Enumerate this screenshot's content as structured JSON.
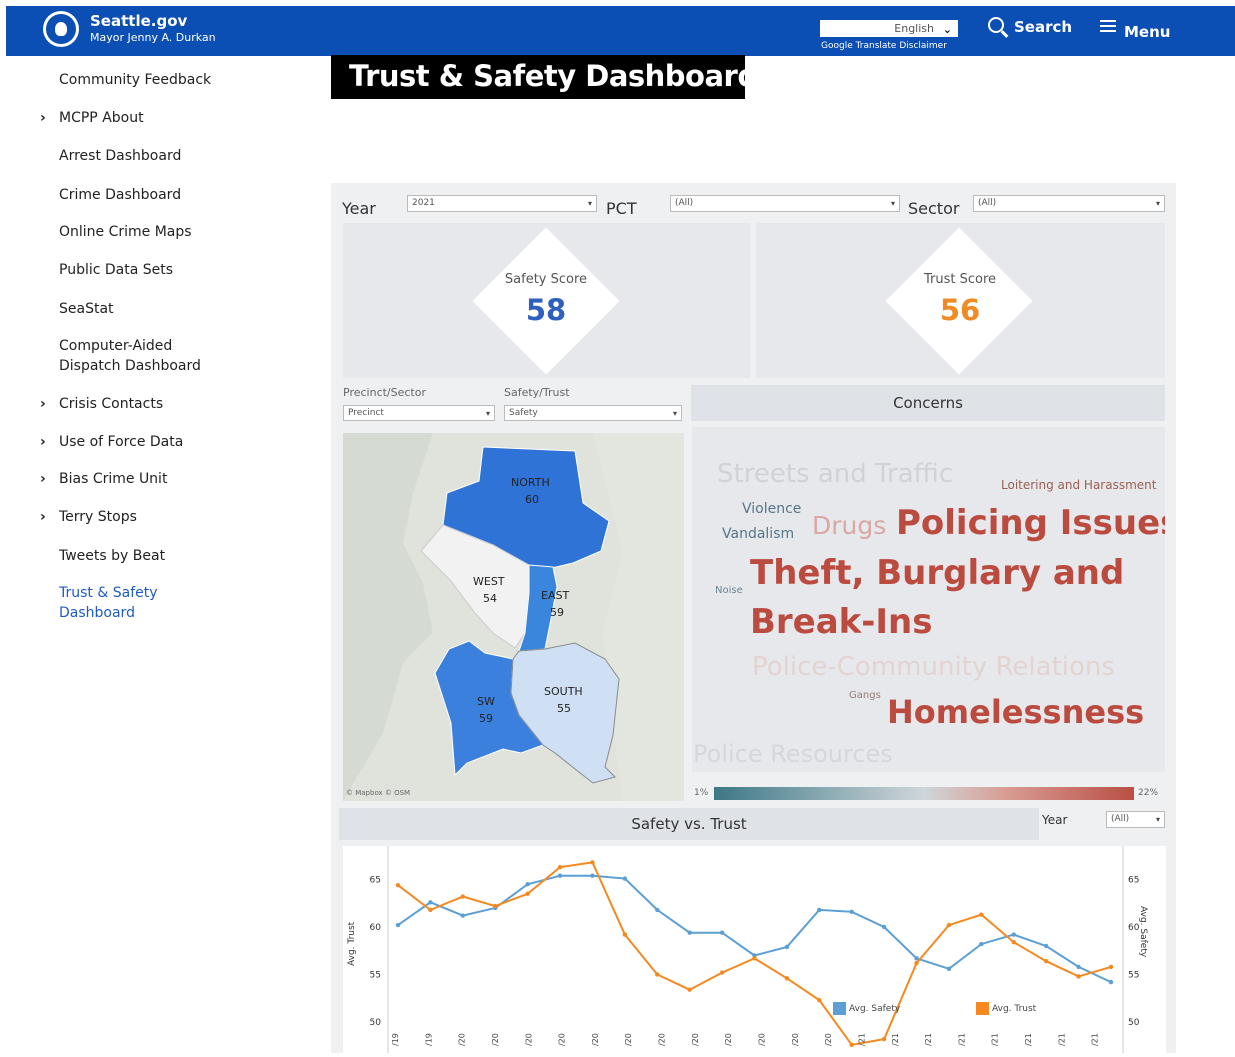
{
  "header": {
    "site_name": "Seattle.gov",
    "mayor": "Mayor Jenny A. Durkan",
    "language": "English",
    "translate_disclaimer": "Google Translate Disclaimer",
    "search_label": "Search",
    "menu_label": "Menu"
  },
  "sidebar": {
    "items": [
      {
        "label": "Community Feedback",
        "has_children": false
      },
      {
        "label": "MCPP About",
        "has_children": true
      },
      {
        "label": "Arrest Dashboard",
        "has_children": false
      },
      {
        "label": "Crime Dashboard",
        "has_children": false
      },
      {
        "label": "Online Crime Maps",
        "has_children": false
      },
      {
        "label": "Public Data Sets",
        "has_children": false
      },
      {
        "label": "SeaStat",
        "has_children": false
      },
      {
        "label": "Computer-Aided Dispatch Dashboard",
        "has_children": false
      },
      {
        "label": "Crisis Contacts",
        "has_children": true
      },
      {
        "label": "Use of Force Data",
        "has_children": true
      },
      {
        "label": "Bias Crime Unit",
        "has_children": true
      },
      {
        "label": "Terry Stops",
        "has_children": true
      },
      {
        "label": "Tweets by Beat",
        "has_children": false
      },
      {
        "label": "Trust & Safety Dashboard",
        "has_children": false,
        "active": true
      }
    ]
  },
  "page_title": "Trust & Safety Dashboard",
  "filters": {
    "year_label": "Year",
    "year_value": "2021",
    "pct_label": "PCT",
    "pct_value": "(All)",
    "sector_label": "Sector",
    "sector_value": "(All)"
  },
  "scores": {
    "safety_label": "Safety Score",
    "safety_value": "58",
    "trust_label": "Trust Score",
    "trust_value": "56",
    "safety_color": "#2f5fbf",
    "trust_color": "#f08a24"
  },
  "map_controls": {
    "precinct_sector_label": "Precinct/Sector",
    "precinct_sector_value": "Precinct",
    "safety_trust_label": "Safety/Trust",
    "safety_trust_value": "Safety"
  },
  "map": {
    "attribution": "© Mapbox © OSM",
    "regions": [
      {
        "name": "NORTH",
        "value": "60"
      },
      {
        "name": "WEST",
        "value": "54"
      },
      {
        "name": "EAST",
        "value": "59"
      },
      {
        "name": "SW",
        "value": "59"
      },
      {
        "name": "SOUTH",
        "value": "55"
      }
    ]
  },
  "concerns": {
    "title": "Concerns",
    "words": {
      "streets": "Streets and Traffic",
      "loitering": "Loitering and Harassment",
      "violence": "Violence",
      "vandalism": "Vandalism",
      "drugs": "Drugs",
      "policing": "Policing Issues",
      "noise": "Noise",
      "theft1": "Theft, Burglary and",
      "theft2": "Break-Ins",
      "pcr": "Police-Community Relations",
      "gangs": "Gangs",
      "homelessness": "Homelessness",
      "resources": "Police Resources"
    },
    "legend_min": "1%",
    "legend_max": "22%"
  },
  "safety_vs_trust": {
    "title": "Safety vs. Trust",
    "year_label": "Year",
    "year_value": "(All)",
    "left_axis": "Avg. Trust",
    "right_axis": "Avg. Safety",
    "legend_safety": "Avg. Safety",
    "legend_trust": "Avg. Trust"
  },
  "chart_data": {
    "type": "line",
    "title": "Safety vs. Trust",
    "ylabel": "Avg. Trust",
    "y2label": "Avg. Safety",
    "ylim": [
      48,
      68
    ],
    "yticks": [
      50,
      55,
      60,
      65
    ],
    "x_tick_labels": [
      "/19",
      "/19",
      "/20",
      "/20",
      "/20",
      "/20",
      "/20",
      "/20",
      "/20",
      "/20",
      "/20",
      "/20",
      "/20",
      "/20",
      "/21",
      "/21",
      "/21",
      "/21",
      "/21",
      "/21",
      "/21",
      "/21"
    ],
    "series": [
      {
        "name": "Avg. Safety",
        "color": "#5b9fd4",
        "values": [
          60.2,
          62.6,
          61.2,
          62.0,
          64.5,
          65.4,
          65.4,
          65.1,
          61.8,
          59.4,
          59.4,
          57.0,
          57.9,
          61.8,
          61.6,
          60.0,
          56.7,
          55.6,
          58.2,
          59.2,
          58.0,
          55.8,
          54.2
        ]
      },
      {
        "name": "Avg. Trust",
        "color": "#f5891f",
        "values": [
          64.4,
          61.8,
          63.2,
          62.2,
          63.5,
          66.3,
          66.8,
          59.2,
          55.0,
          53.4,
          55.2,
          56.7,
          54.6,
          52.3,
          47.6,
          48.2,
          56.2,
          60.2,
          61.3,
          58.4,
          56.4,
          54.8,
          55.8
        ]
      }
    ]
  }
}
